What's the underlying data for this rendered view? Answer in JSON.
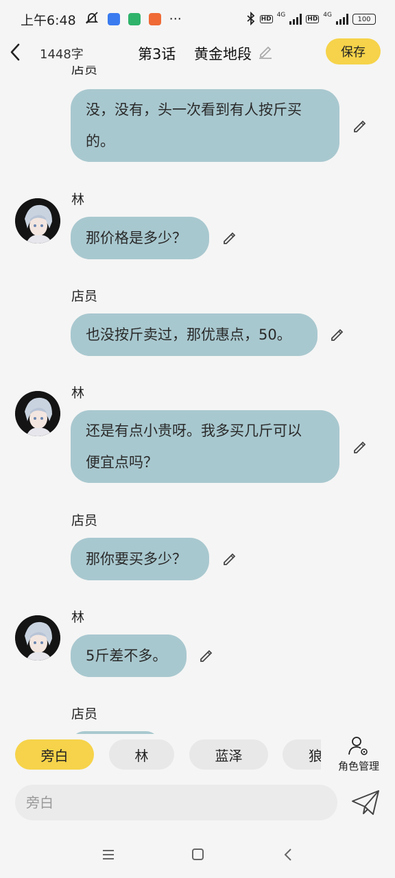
{
  "status_bar": {
    "time": "上午6:48",
    "net_label_1": "4G",
    "net_label_2": "4G",
    "hd_label_1": "HD",
    "hd_label_2": "HD",
    "battery": "100",
    "more": "···"
  },
  "header": {
    "word_count": "1448字",
    "chapter_no": "第3话",
    "chapter_title": "黄金地段",
    "save_label": "保存"
  },
  "messages": [
    {
      "speaker": "店员",
      "text_lines": [
        "没，没有，头一次看到有人按斤买",
        "的。"
      ],
      "has_avatar": false
    },
    {
      "speaker": "林",
      "text_lines": [
        "那价格是多少？"
      ],
      "has_avatar": true
    },
    {
      "speaker": "店员",
      "text_lines": [
        "也没按斤卖过，那优惠点，50。"
      ],
      "has_avatar": false
    },
    {
      "speaker": "林",
      "text_lines": [
        "还是有点小贵呀。我多买几斤可以",
        "便宜点吗？"
      ],
      "has_avatar": true
    },
    {
      "speaker": "店员",
      "text_lines": [
        "那你要买多少？"
      ],
      "has_avatar": false
    },
    {
      "speaker": "林",
      "text_lines": [
        "5斤差不多。"
      ],
      "has_avatar": true
    },
    {
      "speaker": "店员",
      "text_lines": [],
      "has_avatar": false
    }
  ],
  "roles": {
    "chips": [
      "旁白",
      "林",
      "蓝泽",
      "狼"
    ],
    "active_index": 0,
    "manage_label": "角色管理"
  },
  "composer": {
    "placeholder": "旁白"
  },
  "colors": {
    "accent": "#f6d34a",
    "bubble": "#a8c8cf",
    "background": "#f5f5f5"
  },
  "icons": {
    "back": "chevron-left-icon",
    "edit": "pencil-icon",
    "send": "paper-plane-icon",
    "role_manage": "user-gear-icon",
    "nav_menu": "menu-icon",
    "nav_home": "square-home-icon",
    "nav_back": "chevron-back-icon"
  }
}
